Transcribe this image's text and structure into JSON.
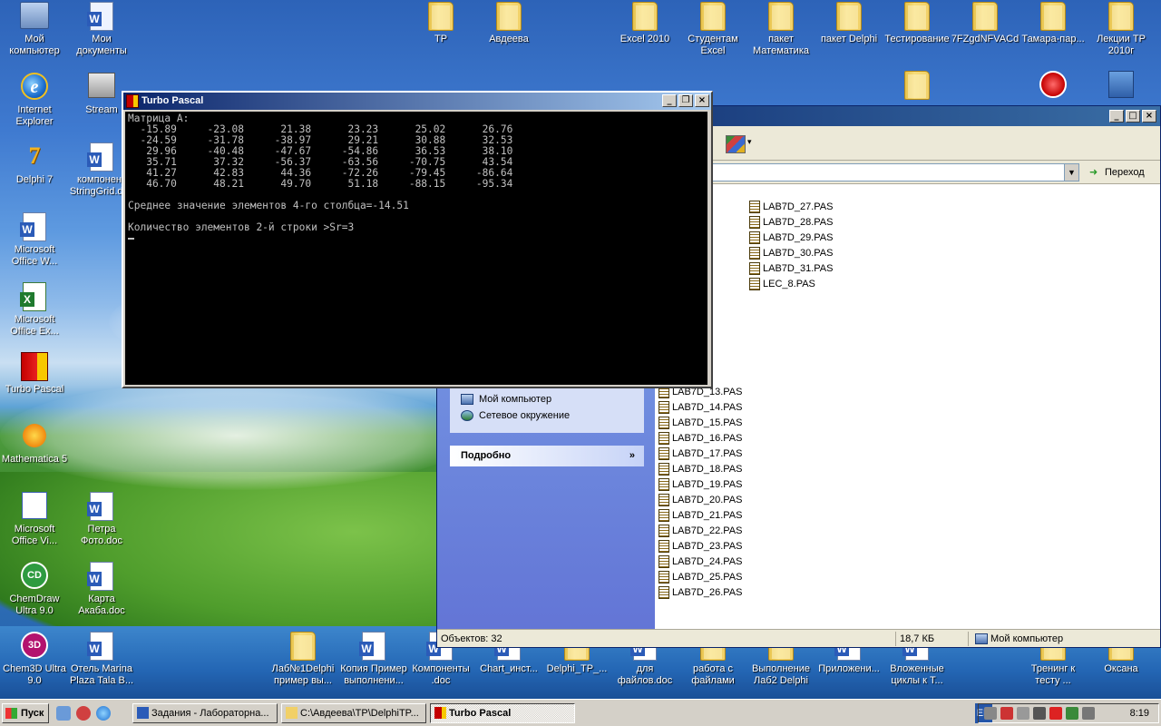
{
  "desktop": {
    "icons_left": [
      {
        "label": "Мой компьютер",
        "icon": "my-computer-icon"
      },
      {
        "label": "Мои документы",
        "icon": "my-documents-icon"
      },
      {
        "label": "Internet Explorer",
        "icon": "internet-explorer-icon"
      },
      {
        "label": "Stream",
        "icon": "stream-icon"
      },
      {
        "label": "Delphi 7",
        "icon": "delphi-icon"
      },
      {
        "label": "компонент StringGrid.doc",
        "icon": "word-doc-icon"
      },
      {
        "label": "Microsoft Office W...",
        "icon": "word-icon"
      },
      {
        "label": "Microsoft Office Ex...",
        "icon": "excel-icon"
      },
      {
        "label": "Turbo Pascal",
        "icon": "turbo-pascal-icon"
      },
      {
        "label": "Mathematica 5",
        "icon": "mathematica-icon"
      },
      {
        "label": "Microsoft Office Vi...",
        "icon": "visio-icon"
      },
      {
        "label": "Петра Фото.doc",
        "icon": "word-doc-icon"
      },
      {
        "label": "ChemDraw Ultra 9.0",
        "icon": "chemdraw-icon"
      },
      {
        "label": "Карта Акаба.doc",
        "icon": "word-doc-icon"
      },
      {
        "label": "Chem3D Ultra 9.0",
        "icon": "chem3d-icon"
      },
      {
        "label": "Отель Marina Plaza Tala B...",
        "icon": "word-doc-icon"
      }
    ],
    "icons_top": [
      {
        "label": "TP",
        "icon": "folder-icon"
      },
      {
        "label": "Авдеева",
        "icon": "folder-icon"
      },
      {
        "label": "Excel 2010",
        "icon": "folder-icon"
      },
      {
        "label": "Студентам Excel",
        "icon": "folder-icon"
      },
      {
        "label": "пакет Математика",
        "icon": "folder-icon"
      },
      {
        "label": "пакет Delphi",
        "icon": "folder-icon"
      },
      {
        "label": "Тестирование",
        "icon": "folder-icon"
      },
      {
        "label": "7FZgdNFVACd",
        "icon": "folder-icon"
      },
      {
        "label": "Тамара-пар...",
        "icon": "folder-icon"
      },
      {
        "label": "Лекции ТР 2010г",
        "icon": "folder-icon"
      }
    ],
    "icons_bottom": [
      {
        "label": "Лаб№1Delphi пример вы...",
        "icon": "folder-icon"
      },
      {
        "label": "Копия Пример выполнени...",
        "icon": "word-doc-icon"
      },
      {
        "label": "Компоненты .doc",
        "icon": "word-doc-icon"
      },
      {
        "label": "Chart_инст...",
        "icon": "word-doc-icon"
      },
      {
        "label": "Delphi_TP_...",
        "icon": "folder-icon"
      },
      {
        "label": "для файлов.doc",
        "icon": "word-doc-icon"
      },
      {
        "label": "работа с файлами",
        "icon": "folder-icon"
      },
      {
        "label": "Выполнение Лаб2 Delphi",
        "icon": "folder-icon"
      },
      {
        "label": "Приложени...",
        "icon": "word-doc-icon"
      },
      {
        "label": "Вложенные циклы к Т...",
        "icon": "word-doc-icon"
      },
      {
        "label": "Тренинг к тесту ...",
        "icon": "folder-icon"
      },
      {
        "label": "Оксана",
        "icon": "folder-icon"
      }
    ]
  },
  "turbo_pascal": {
    "title": "Turbo Pascal",
    "console_lines": [
      "Матрица A:",
      "  -15.89     -23.08      21.38      23.23      25.02      26.76",
      "  -24.59     -31.78     -38.97      29.21      30.88      32.53",
      "   29.96     -40.48     -47.67     -54.86      36.53      38.10",
      "   35.71      37.32     -56.37     -63.56     -70.75      43.54",
      "   41.27      42.83      44.36     -72.26     -79.45     -86.64",
      "   46.70      48.21      49.70      51.18     -88.15     -95.34",
      "",
      "Среднее значение элементов 4-го столбца=-14.51",
      "",
      "Количество элементов 2-й строки >Sr=3"
    ]
  },
  "explorer": {
    "go_label": "Переход",
    "tasks": [
      {
        "label": "Мой компьютер"
      },
      {
        "label": "Сетевое окружение"
      }
    ],
    "details_header": "Подробно",
    "files_col1": [
      "...PAS",
      "...PAS",
      "...PAS",
      "...PAS",
      "...PAS",
      "...PAS",
      "...PAS",
      "...PAS",
      "...PAS",
      "...0.PAS",
      "...1.PAS",
      "...2.PAS",
      "LAB7D_13.PAS",
      "LAB7D_14.PAS",
      "LAB7D_15.PAS",
      "LAB7D_16.PAS",
      "LAB7D_17.PAS",
      "LAB7D_18.PAS",
      "LAB7D_19.PAS",
      "LAB7D_20.PAS",
      "LAB7D_21.PAS",
      "LAB7D_22.PAS",
      "LAB7D_23.PAS",
      "LAB7D_24.PAS",
      "LAB7D_25.PAS",
      "LAB7D_26.PAS"
    ],
    "files_col2": [
      "LAB7D_27.PAS",
      "LAB7D_28.PAS",
      "LAB7D_29.PAS",
      "LAB7D_30.PAS",
      "LAB7D_31.PAS",
      "LEC_8.PAS"
    ],
    "status": {
      "objects": "Объектов: 32",
      "size": "18,7 КБ",
      "location": "Мой компьютер"
    }
  },
  "taskbar": {
    "start_label": "Пуск",
    "items": [
      {
        "label": "Задания - Лабораторна..."
      },
      {
        "label": "C:\\Авдеева\\TP\\DelphiTP..."
      },
      {
        "label": "Turbo Pascal"
      }
    ],
    "language": "EN",
    "clock": "8:19"
  },
  "colors": {
    "console_bg": "#000000",
    "console_fg": "#c0c0c0",
    "titlebar": "#0a246a",
    "explorer_panel": "#6375d6"
  }
}
